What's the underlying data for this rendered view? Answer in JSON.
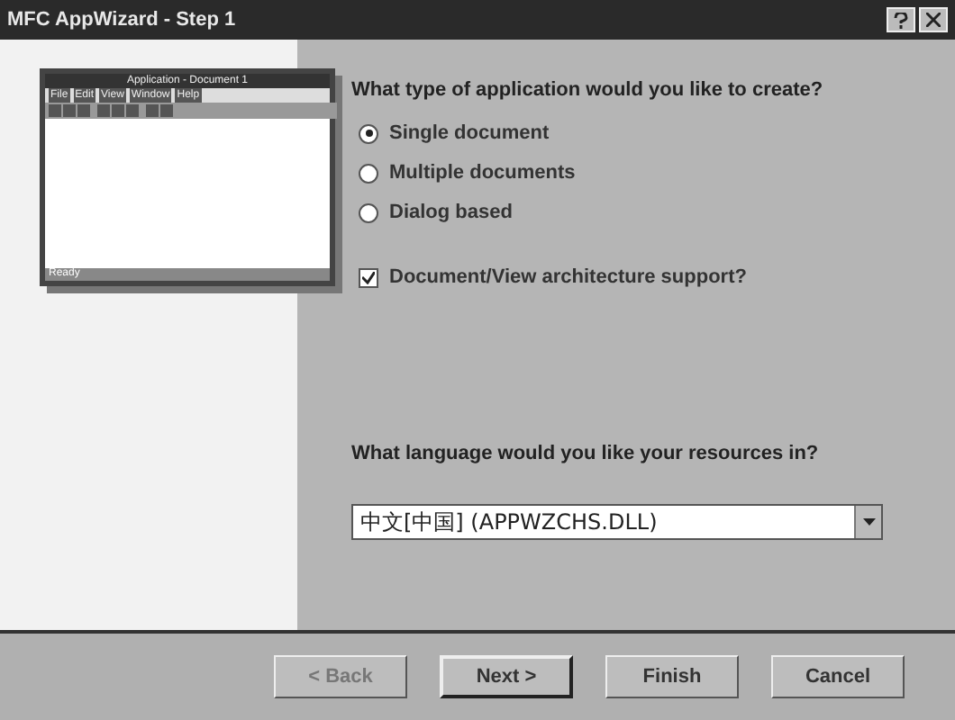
{
  "window": {
    "title": "MFC AppWizard - Step 1"
  },
  "preview": {
    "title": "Application - Document 1",
    "menu": [
      "File",
      "Edit",
      "View",
      "Window",
      "Help"
    ],
    "status": "Ready"
  },
  "question": "What type of application would you like to create?",
  "app_types": [
    {
      "label": "Single document",
      "selected": true
    },
    {
      "label": "Multiple documents",
      "selected": false
    },
    {
      "label": "Dialog based",
      "selected": false
    }
  ],
  "doc_view": {
    "label": "Document/View architecture support?",
    "checked": true
  },
  "language_question": "What language would you like your resources in?",
  "language": {
    "value": "中文[中国] (APPWZCHS.DLL)"
  },
  "buttons": [
    {
      "label": "< Back",
      "disabled": true,
      "default": false
    },
    {
      "label": "Next >",
      "disabled": false,
      "default": true
    },
    {
      "label": "Finish",
      "disabled": false,
      "default": false
    },
    {
      "label": "Cancel",
      "disabled": false,
      "default": false
    }
  ]
}
